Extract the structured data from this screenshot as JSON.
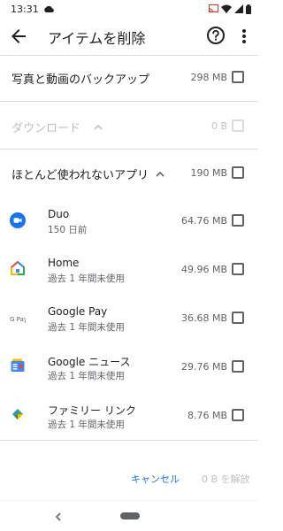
{
  "status_bar": {
    "time": "13:31",
    "icons": [
      "cloud-icon",
      "cast-icon",
      "wifi-icon",
      "signal-icon",
      "battery-icon"
    ]
  },
  "toolbar": {
    "title": "アイテムを削除",
    "back_icon": "arrow-back-icon",
    "help_icon": "help-icon",
    "more_icon": "more-vert-icon"
  },
  "sections": {
    "backup": {
      "label": "写真と動画のバックアップ",
      "size": "298 MB"
    },
    "downloads": {
      "label": "ダウンロード",
      "size": "0 B"
    },
    "rarely_used": {
      "label": "ほとんど使われないアプリ",
      "size": "190 MB"
    }
  },
  "apps": [
    {
      "name": "Duo",
      "sub": "150 日前",
      "size": "64.76 MB",
      "icon": "duo-icon"
    },
    {
      "name": "Home",
      "sub": "過去 1 年間未使用",
      "size": "49.96 MB",
      "icon": "home-icon"
    },
    {
      "name": "Google Pay",
      "sub": "過去 1 年間未使用",
      "size": "36.68 MB",
      "icon": "gpay-icon"
    },
    {
      "name": "Google ニュース",
      "sub": "過去 1 年間未使用",
      "size": "29.76 MB",
      "icon": "news-icon"
    },
    {
      "name": "ファミリー リンク",
      "sub": "過去 1 年間未使用",
      "size": "8.76 MB",
      "icon": "family-link-icon"
    }
  ],
  "gpay_icon_text": "G Pay",
  "footer": {
    "cancel_label": "キャンセル",
    "release_label": "0 B を解放"
  },
  "colors": {
    "accent": "#1a73e8",
    "text_primary": "#202124",
    "text_secondary": "#5f6368",
    "disabled": "#bdc1c6",
    "divider": "#dadce0"
  }
}
